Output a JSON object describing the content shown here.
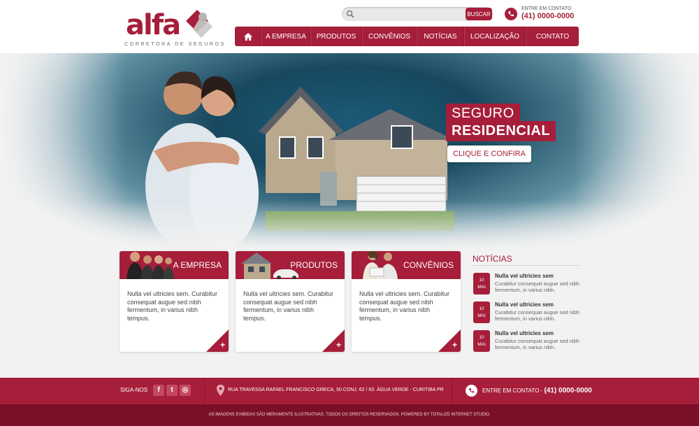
{
  "brand": {
    "name": "alfa",
    "tagline": "CORRETORA DE SEGUROS",
    "color": "#a61e3a"
  },
  "search": {
    "placeholder": "",
    "button_label": "BUSCAR"
  },
  "contact_top": {
    "label": "ENTRE EM CONTATO",
    "phone": "(41) 0000-0000"
  },
  "nav": {
    "items": [
      {
        "label": "A EMPRESA"
      },
      {
        "label": "PRODUTOS"
      },
      {
        "label": "CONVÊNIOS"
      },
      {
        "label": "NOTÍCIAS"
      },
      {
        "label": "LOCALIZAÇÃO"
      },
      {
        "label": "CONTATO"
      }
    ]
  },
  "hero": {
    "title_line1": "SEGURO",
    "title_line2": "RESIDENCIAL",
    "cta": "CLIQUE E CONFIRA"
  },
  "boxes": [
    {
      "title": "A EMPRESA",
      "text": "Nulla vel ultricies sem. Curabitur consequat augue sed nibh fermentum, in varius nibh tempus.",
      "plus": "+"
    },
    {
      "title": "PRODUTOS",
      "text": "Nulla vel ultricies sem. Curabitur consequat augue sed nibh fermentum, in varius nibh tempus.",
      "plus": "+"
    },
    {
      "title": "CONVÊNIOS",
      "text": "Nulla vel ultricies sem. Curabitur consequat augue sed nibh fermentum, in varius nibh tempus.",
      "plus": "+"
    }
  ],
  "news": {
    "title": "NOTÍCIAS",
    "items": [
      {
        "day": "10",
        "month": "MAI",
        "headline": "Nulla vel ultricies sem",
        "body": "Curabitur consequat augue sed nibh fermentum, in varius nibh."
      },
      {
        "day": "10",
        "month": "MAI",
        "headline": "Nulla vel ultricies sem",
        "body": "Curabitur consequat augue sed nibh fermentum, in varius nibh."
      },
      {
        "day": "10",
        "month": "MAI",
        "headline": "Nulla vel ultricies sem",
        "body": "Curabitur consequat augue sed nibh fermentum, in varius nibh."
      }
    ]
  },
  "footer": {
    "follow_label": "SIGA-NOS",
    "social": [
      "f",
      "t",
      "◎"
    ],
    "address": "RUA TRAVESSA RAFAEL FRANCISCO GRECA, 50 CONJ. 62 / 63. ÁGUA VERDE - CURITIBA PR",
    "contact_label": "ENTRE EM CONTATO -",
    "contact_phone": "(41) 0000-0000",
    "legal": "AS IMAGENS EXIBIDAS SÃO MERAMENTE ILUSTRATIVAS. TODOS OS DIREITOS RESERVADOS. POWERED BY TOTALIZE INTERNET STUDIO."
  }
}
